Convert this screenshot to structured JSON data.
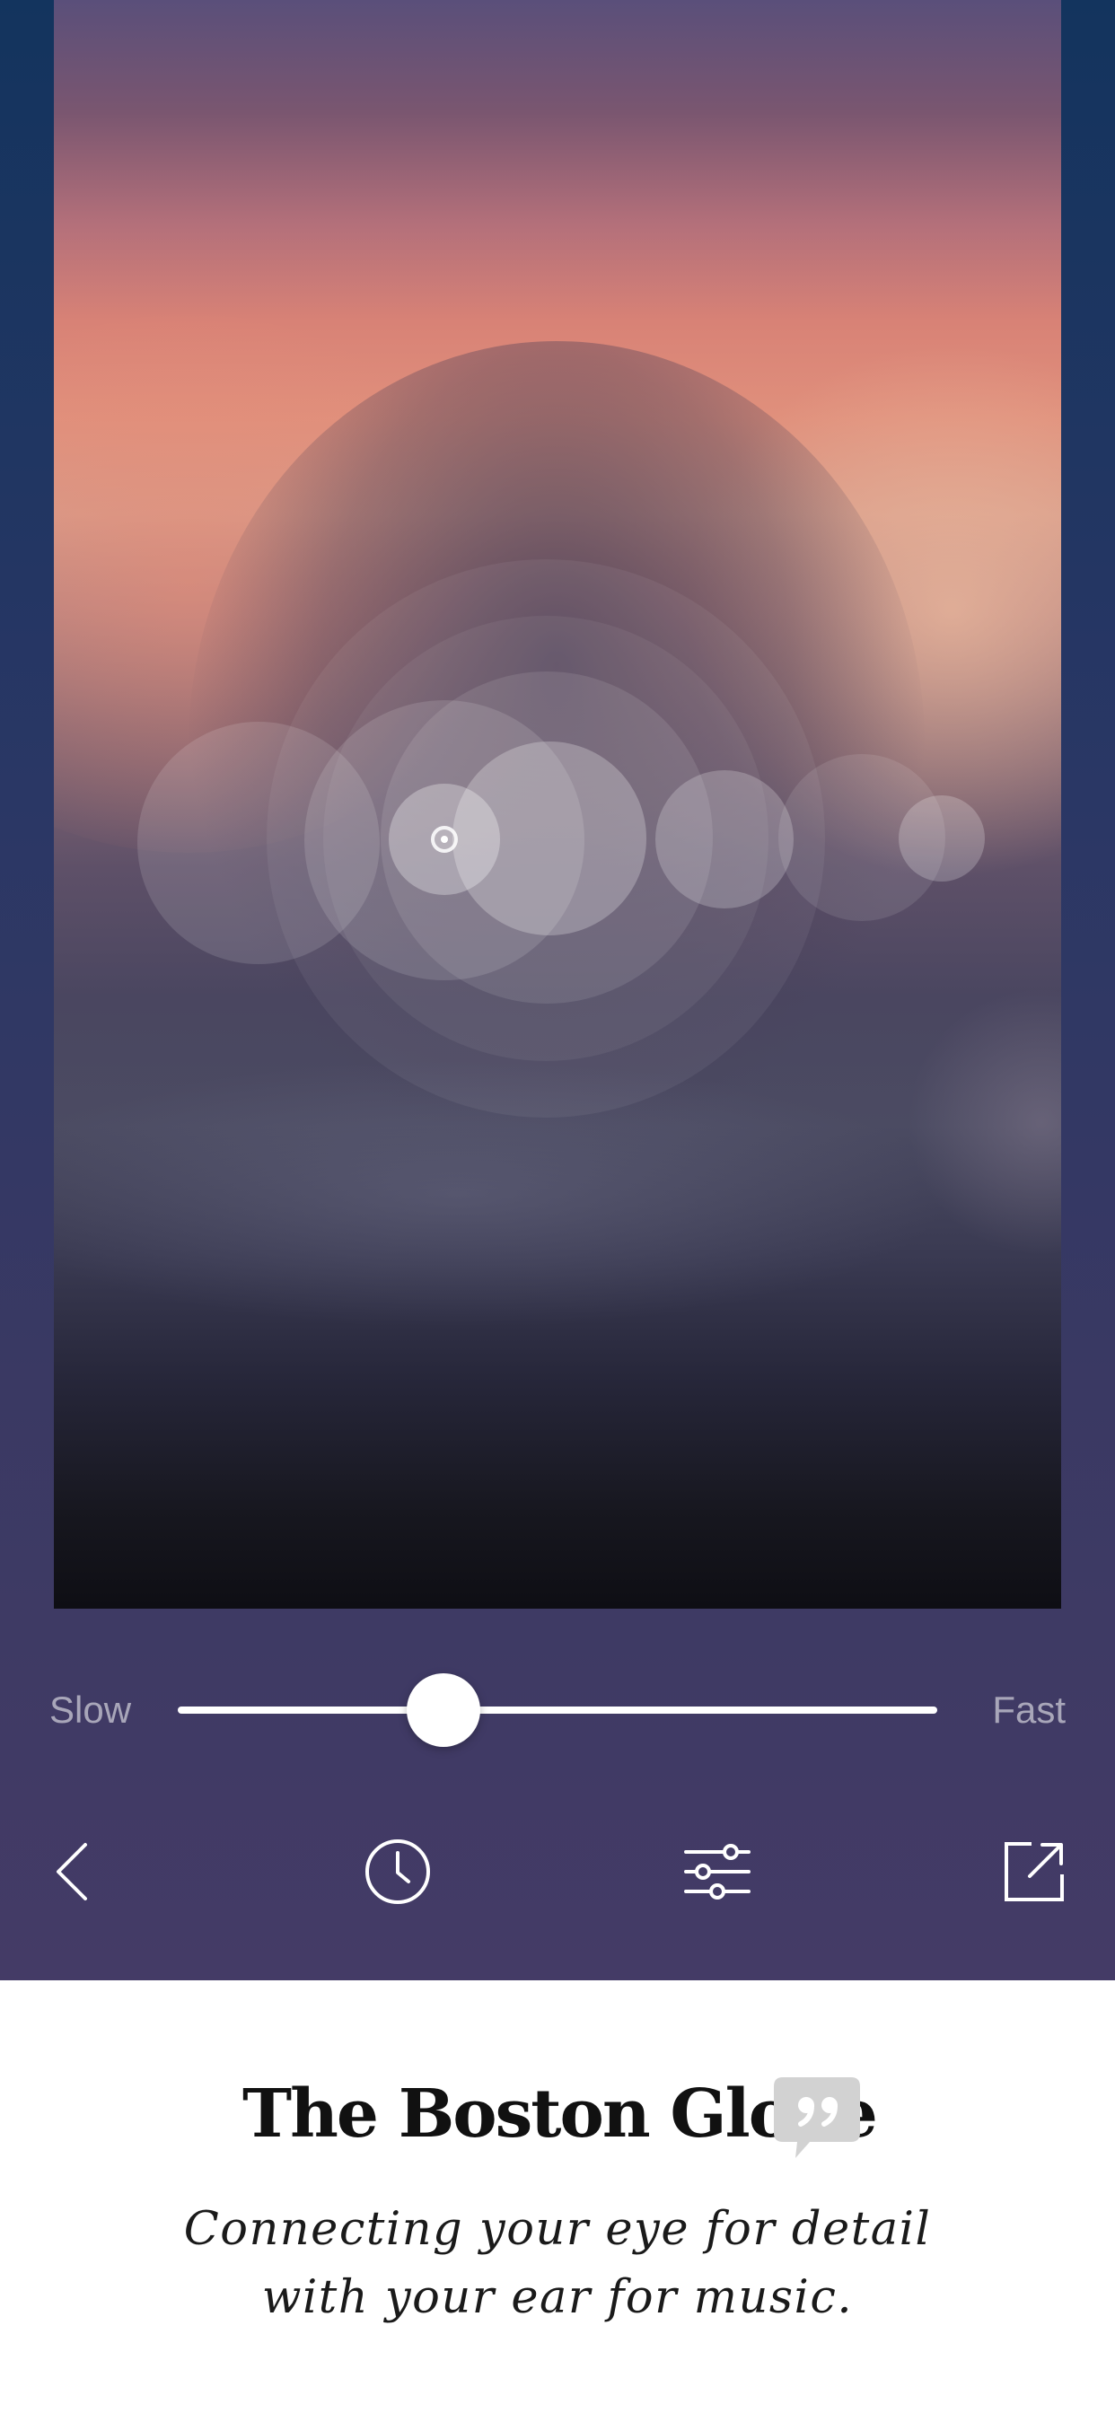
{
  "player": {
    "speed_slider": {
      "min_label": "Slow",
      "max_label": "Fast",
      "value": 0.35
    }
  },
  "toolbar": {
    "items": [
      {
        "icon": "chevron-left-icon"
      },
      {
        "icon": "clock-icon"
      },
      {
        "icon": "sliders-icon"
      },
      {
        "icon": "share-icon"
      }
    ]
  },
  "ad": {
    "brand": "The Boston Globe",
    "tagline_line1": "Connecting your eye for detail",
    "tagline_line2": "with your ear for music.",
    "icon": "quote-bubble-icon"
  },
  "colors": {
    "panel_bg": "#3a3963",
    "accent": "#ffffff",
    "ad_bg": "#ffffff"
  }
}
